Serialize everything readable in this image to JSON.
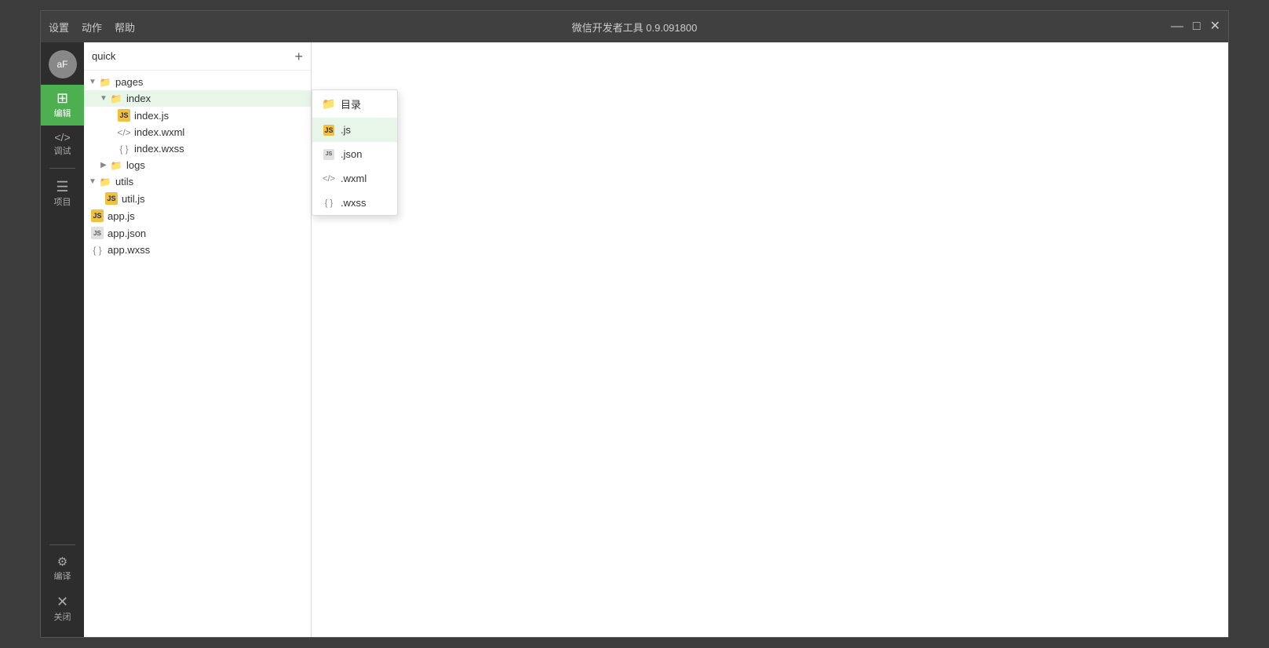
{
  "titlebar": {
    "menu": [
      "设置",
      "动作",
      "帮助"
    ],
    "title": "微信开发者工具 0.9.091800",
    "controls": {
      "minimize": "—",
      "maximize": "□",
      "close": "✕"
    }
  },
  "sidebar": {
    "avatar_text": "aF",
    "items": [
      {
        "id": "editor",
        "label": "编辑",
        "icon": "✦",
        "active": true
      },
      {
        "id": "debug",
        "label": "调试",
        "icon": "</>"
      },
      {
        "id": "project",
        "label": "项目",
        "icon": "≡"
      }
    ],
    "bottom_items": [
      {
        "id": "compile",
        "label": "编译",
        "icon": "⛭"
      },
      {
        "id": "close",
        "label": "关闭",
        "icon": "✕"
      }
    ]
  },
  "file_panel": {
    "title": "quick",
    "add_button": "+",
    "tree": [
      {
        "level": 0,
        "type": "folder",
        "name": "pages",
        "expanded": true,
        "arrow": "▼"
      },
      {
        "level": 1,
        "type": "folder",
        "name": "index",
        "expanded": true,
        "arrow": "▼",
        "selected": true
      },
      {
        "level": 2,
        "type": "js",
        "name": "index.js"
      },
      {
        "level": 2,
        "type": "wxml",
        "name": "index.wxml"
      },
      {
        "level": 2,
        "type": "wxss",
        "name": "index.wxss"
      },
      {
        "level": 1,
        "type": "folder",
        "name": "logs",
        "expanded": false,
        "arrow": "▶"
      },
      {
        "level": 0,
        "type": "folder",
        "name": "utils",
        "expanded": true,
        "arrow": "▼"
      },
      {
        "level": 1,
        "type": "js",
        "name": "util.js"
      },
      {
        "level": 0,
        "type": "js",
        "name": "app.js"
      },
      {
        "level": 0,
        "type": "json",
        "name": "app.json"
      },
      {
        "level": 0,
        "type": "wxss",
        "name": "app.wxss"
      }
    ]
  },
  "context_menu": {
    "items": [
      {
        "id": "directory",
        "label": "目录",
        "icon": "folder",
        "highlighted": false
      },
      {
        "id": "js",
        "label": ".js",
        "icon": "js",
        "highlighted": true
      },
      {
        "id": "json",
        "label": ".json",
        "icon": "json",
        "highlighted": false
      },
      {
        "id": "wxml",
        "label": ".wxml",
        "icon": "wxml",
        "highlighted": false
      },
      {
        "id": "wxss",
        "label": ".wxss",
        "icon": "wxss",
        "highlighted": false
      }
    ]
  }
}
